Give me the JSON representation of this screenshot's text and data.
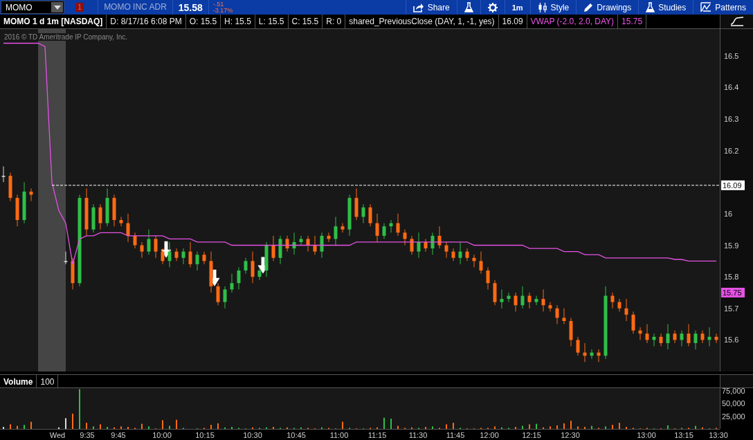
{
  "symbol_bar": {
    "symbol": "MOMO",
    "alert_count": "1",
    "company": "MOMO INC ADR",
    "last": "15.58",
    "change": "-.51",
    "change_pct": "-3.17%"
  },
  "toolbar": [
    {
      "kind": "share",
      "label": "Share"
    },
    {
      "kind": "flask"
    },
    {
      "kind": "gear"
    },
    {
      "kind": "text",
      "label": "1m"
    },
    {
      "kind": "style",
      "label": "Style"
    },
    {
      "kind": "pencil",
      "label": "Drawings"
    },
    {
      "kind": "flask",
      "label": "Studies"
    },
    {
      "kind": "patterns",
      "label": "Patterns"
    }
  ],
  "legend": [
    {
      "kind": "title",
      "text": "MOMO 1 d 1m [NASDAQ]"
    },
    {
      "kind": "plain",
      "text": "D: 8/17/16 6:08 PM"
    },
    {
      "kind": "plain",
      "text": "O: 15.5"
    },
    {
      "kind": "plain",
      "text": "H: 15.5"
    },
    {
      "kind": "plain",
      "text": "L: 15.5"
    },
    {
      "kind": "plain",
      "text": "C: 15.5"
    },
    {
      "kind": "plain",
      "text": "R: 0"
    },
    {
      "kind": "plain",
      "text": "shared_PreviousClose (DAY, 1, -1, yes)"
    },
    {
      "kind": "plain",
      "text": "16.09"
    },
    {
      "kind": "study",
      "text": "VWAP (-2.0, 2.0, DAY)"
    },
    {
      "kind": "study",
      "text": "15.75"
    }
  ],
  "copyright": "2016 © TD Ameritrade IP Company, Inc.",
  "price_badges": [
    {
      "kind": "previous_close",
      "text": "16.09",
      "color": "#ffffff"
    },
    {
      "kind": "vwap",
      "text": "15.75",
      "color": "#e552e5"
    }
  ],
  "price_chart": {
    "chart_data": {
      "type": "candlestick",
      "ylim": [
        15.5,
        16.585
      ],
      "categories": [
        null,
        null,
        null,
        null,
        null,
        null,
        null,
        null,
        null,
        null,
        null,
        null,
        null,
        null,
        null,
        null,
        null,
        null,
        null,
        null,
        null,
        null,
        null,
        null,
        null,
        null,
        null,
        null,
        null,
        null,
        null,
        null,
        null,
        null,
        null,
        null,
        null,
        null,
        null,
        null,
        null,
        null,
        null,
        null,
        null,
        null,
        null,
        null,
        null,
        null,
        null,
        null,
        null,
        null,
        null,
        null,
        null,
        null,
        null,
        null,
        null,
        null,
        null,
        null,
        null,
        null,
        null,
        null,
        null,
        null,
        null,
        null,
        null,
        null,
        null,
        null,
        null,
        null,
        null,
        null,
        null,
        null,
        null,
        null,
        null,
        null,
        null,
        null,
        null,
        null,
        null,
        null,
        null,
        null,
        null,
        null,
        null,
        null,
        null,
        null,
        null,
        null,
        null,
        null
      ],
      "yticks": [
        {
          "value": 15.6,
          "label": "15.6"
        },
        {
          "value": 15.7,
          "label": "15.7"
        },
        {
          "value": 15.8,
          "label": "15.8"
        },
        {
          "value": 15.9,
          "label": "15.9"
        },
        {
          "value": 16,
          "label": "16"
        },
        {
          "value": 16.2,
          "label": "16.2"
        },
        {
          "value": 16.3,
          "label": "16.3"
        },
        {
          "value": 16.4,
          "label": "16.4"
        },
        {
          "value": 16.5,
          "label": "16.5"
        }
      ],
      "ref_lines": [
        {
          "axis": "y",
          "value": 16.09
        }
      ],
      "ohlc": [
        [
          16.12,
          16.15,
          16.1,
          16.12
        ],
        [
          16.12,
          16.13,
          16.04,
          16.05
        ],
        [
          16.05,
          16.06,
          15.96,
          15.98
        ],
        [
          15.98,
          16.1,
          15.97,
          16.07
        ],
        [
          16.07,
          16.08,
          16.04,
          16.06
        ],
        null,
        null,
        null,
        null,
        [
          15.85,
          15.88,
          15.84,
          15.85
        ],
        [
          15.85,
          15.86,
          15.76,
          15.78
        ],
        [
          15.78,
          16.06,
          15.77,
          16.05
        ],
        [
          16.05,
          16.08,
          15.93,
          15.95
        ],
        [
          15.95,
          16.03,
          15.94,
          16.02
        ],
        [
          16.02,
          16.03,
          15.95,
          15.97
        ],
        [
          15.97,
          16.08,
          15.96,
          16.05
        ],
        [
          16.05,
          16.06,
          15.96,
          15.98
        ],
        [
          15.98,
          15.99,
          15.96,
          15.97
        ],
        [
          15.97,
          16,
          15.91,
          15.93
        ],
        [
          15.93,
          15.94,
          15.89,
          15.9
        ],
        [
          15.9,
          15.91,
          15.86,
          15.88
        ],
        [
          15.88,
          15.95,
          15.87,
          15.92
        ],
        [
          15.92,
          15.93,
          15.86,
          15.88
        ],
        [
          15.88,
          15.89,
          15.84,
          15.85
        ],
        [
          15.85,
          15.91,
          15.83,
          15.88
        ],
        [
          15.88,
          15.89,
          15.85,
          15.86
        ],
        [
          15.86,
          15.89,
          15.84,
          15.88
        ],
        [
          15.88,
          15.91,
          15.83,
          15.84
        ],
        [
          15.84,
          15.88,
          15.82,
          15.87
        ],
        [
          15.87,
          15.88,
          15.84,
          15.85
        ],
        [
          15.85,
          15.88,
          15.75,
          15.77
        ],
        [
          15.77,
          15.78,
          15.71,
          15.72
        ],
        [
          15.72,
          15.77,
          15.7,
          15.76
        ],
        [
          15.76,
          15.81,
          15.75,
          15.78
        ],
        [
          15.78,
          15.83,
          15.76,
          15.82
        ],
        [
          15.82,
          15.86,
          15.81,
          15.85
        ],
        [
          15.85,
          15.88,
          15.78,
          15.8
        ],
        [
          15.8,
          15.83,
          15.79,
          15.82
        ],
        [
          15.82,
          15.91,
          15.8,
          15.9
        ],
        [
          15.9,
          15.93,
          15.85,
          15.86
        ],
        [
          15.86,
          15.93,
          15.84,
          15.92
        ],
        [
          15.92,
          15.93,
          15.88,
          15.89
        ],
        [
          15.89,
          15.94,
          15.87,
          15.91
        ],
        [
          15.91,
          15.93,
          15.9,
          15.92
        ],
        [
          15.92,
          15.93,
          15.88,
          15.9
        ],
        [
          15.9,
          15.93,
          15.87,
          15.88
        ],
        [
          15.88,
          15.94,
          15.86,
          15.93
        ],
        [
          15.93,
          15.94,
          15.91,
          15.92
        ],
        [
          15.92,
          15.99,
          15.9,
          15.96
        ],
        [
          15.96,
          15.97,
          15.94,
          15.95
        ],
        [
          15.95,
          16.06,
          15.93,
          16.05
        ],
        [
          16.05,
          16.08,
          15.98,
          15.99
        ],
        [
          15.99,
          16.03,
          15.97,
          16.02
        ],
        [
          16.02,
          16.03,
          15.96,
          15.97
        ],
        [
          15.97,
          16,
          15.91,
          15.93
        ],
        [
          15.93,
          15.97,
          15.92,
          15.96
        ],
        [
          15.96,
          15.98,
          15.94,
          15.97
        ],
        [
          15.97,
          16,
          15.93,
          15.94
        ],
        [
          15.94,
          15.95,
          15.9,
          15.92
        ],
        [
          15.92,
          15.93,
          15.87,
          15.88
        ],
        [
          15.88,
          15.94,
          15.86,
          15.91
        ],
        [
          15.91,
          15.92,
          15.88,
          15.89
        ],
        [
          15.89,
          15.94,
          15.87,
          15.93
        ],
        [
          15.93,
          15.96,
          15.89,
          15.9
        ],
        [
          15.9,
          15.91,
          15.86,
          15.88
        ],
        [
          15.88,
          15.89,
          15.85,
          15.86
        ],
        [
          15.86,
          15.91,
          15.84,
          15.88
        ],
        [
          15.88,
          15.89,
          15.85,
          15.86
        ],
        [
          15.86,
          15.87,
          15.83,
          15.85
        ],
        [
          15.85,
          15.88,
          15.81,
          15.82
        ],
        [
          15.82,
          15.83,
          15.76,
          15.78
        ],
        [
          15.78,
          15.79,
          15.71,
          15.72
        ],
        [
          15.72,
          15.76,
          15.7,
          15.73
        ],
        [
          15.73,
          15.75,
          15.72,
          15.74
        ],
        [
          15.74,
          15.75,
          15.69,
          15.71
        ],
        [
          15.71,
          15.77,
          15.7,
          15.74
        ],
        [
          15.74,
          15.75,
          15.7,
          15.72
        ],
        [
          15.72,
          15.74,
          15.71,
          15.73
        ],
        [
          15.73,
          15.76,
          15.69,
          15.71
        ],
        [
          15.71,
          15.72,
          15.69,
          15.7
        ],
        [
          15.7,
          15.71,
          15.65,
          15.67
        ],
        [
          15.67,
          15.7,
          15.65,
          15.66
        ],
        [
          15.66,
          15.67,
          15.58,
          15.6
        ],
        [
          15.6,
          15.61,
          15.55,
          15.56
        ],
        [
          15.56,
          15.59,
          15.53,
          15.55
        ],
        [
          15.55,
          15.57,
          15.54,
          15.56
        ],
        [
          15.56,
          15.57,
          15.53,
          15.55
        ],
        [
          15.55,
          15.77,
          15.54,
          15.74
        ],
        [
          15.74,
          15.75,
          15.7,
          15.72
        ],
        [
          15.72,
          15.73,
          15.69,
          15.7
        ],
        [
          15.7,
          15.73,
          15.66,
          15.68
        ],
        [
          15.68,
          15.69,
          15.62,
          15.63
        ],
        [
          15.63,
          15.64,
          15.6,
          15.62
        ],
        [
          15.62,
          15.65,
          15.59,
          15.6
        ],
        [
          15.6,
          15.62,
          15.58,
          15.61
        ],
        [
          15.61,
          15.62,
          15.58,
          15.59
        ],
        [
          15.59,
          15.65,
          15.57,
          15.62
        ],
        [
          15.62,
          15.63,
          15.59,
          15.6
        ],
        [
          15.6,
          15.63,
          15.58,
          15.62
        ],
        [
          15.62,
          15.65,
          15.58,
          15.59
        ],
        [
          15.59,
          15.63,
          15.57,
          15.62
        ],
        [
          15.62,
          15.63,
          15.59,
          15.6
        ],
        [
          15.6,
          15.64,
          15.58,
          15.61
        ],
        [
          15.61,
          15.62,
          15.59,
          15.6
        ]
      ],
      "series": [
        {
          "type": "line",
          "color": "#e552e5",
          "values": [
            16.54,
            16.54,
            16.54,
            16.54,
            16.54,
            16.54,
            16.53,
            16.1,
            16.01,
            15.97,
            15.84,
            15.92,
            15.93,
            15.93,
            15.94,
            15.94,
            15.94,
            15.94,
            15.93,
            15.93,
            15.93,
            15.93,
            15.93,
            15.93,
            15.92,
            15.92,
            15.92,
            15.92,
            15.91,
            15.91,
            15.91,
            15.91,
            15.91,
            15.9,
            15.9,
            15.9,
            15.9,
            15.9,
            15.9,
            15.9,
            15.9,
            15.9,
            15.9,
            15.9,
            15.9,
            15.9,
            15.9,
            15.9,
            15.9,
            15.9,
            15.9,
            15.91,
            15.91,
            15.91,
            15.91,
            15.91,
            15.91,
            15.91,
            15.91,
            15.91,
            15.91,
            15.91,
            15.91,
            15.91,
            15.91,
            15.91,
            15.91,
            15.91,
            15.9,
            15.9,
            15.9,
            15.9,
            15.9,
            15.9,
            15.9,
            15.9,
            15.89,
            15.89,
            15.89,
            15.89,
            15.89,
            15.88,
            15.88,
            15.88,
            15.87,
            15.87,
            15.87,
            15.86,
            15.86,
            15.86,
            15.86,
            15.86,
            15.86,
            15.86,
            15.86,
            15.86,
            15.86,
            15.855,
            15.855,
            15.85,
            15.85,
            15.85,
            15.85,
            15.85
          ]
        }
      ]
    }
  },
  "time_axis": [
    "Wed",
    "9:35",
    "9:45",
    "10:00",
    "10:15",
    "10:30",
    "10:45",
    "11:00",
    "11:15",
    "11:30",
    "11:45",
    "12:00",
    "12:15",
    "12:30",
    "13:00",
    "13:15",
    "13:30"
  ],
  "volume_pane": {
    "label": "Volume",
    "value": "100",
    "chart_data": {
      "type": "bar",
      "ylim": [
        0,
        80000
      ],
      "yticks": [
        {
          "value": 25000,
          "label": "25,000"
        },
        {
          "value": 50000,
          "label": "50,000"
        },
        {
          "value": 75000,
          "label": "75,000"
        }
      ],
      "series": [
        {
          "color": "#2fbf48",
          "values": [
            null,
            null,
            null,
            8000,
            null,
            null,
            null,
            null,
            null,
            null,
            null,
            78000,
            null,
            5000,
            null,
            4000,
            null,
            null,
            null,
            null,
            null,
            5000,
            null,
            null,
            6000,
            null,
            2000,
            null,
            1000,
            null,
            null,
            null,
            3000,
            4000,
            2000,
            1000,
            null,
            2000,
            3000,
            null,
            2000,
            null,
            2000,
            3000,
            null,
            null,
            3000,
            null,
            1000,
            null,
            2000,
            null,
            1000,
            null,
            null,
            22000,
            20000,
            null,
            null,
            null,
            2000,
            null,
            5000,
            null,
            null,
            null,
            2000,
            null,
            null,
            null,
            null,
            null,
            3000,
            2000,
            null,
            6000,
            null,
            10000,
            null,
            null,
            null,
            null,
            null,
            null,
            null,
            6000,
            null,
            5000,
            null,
            null,
            null,
            null,
            null,
            null,
            1000,
            null,
            7000,
            null,
            2000,
            null,
            6000,
            null,
            1000,
            null
          ]
        },
        {
          "color": "#ff6a13",
          "values": [
            null,
            9000,
            6000,
            null,
            14000,
            null,
            null,
            null,
            null,
            null,
            30000,
            null,
            12000,
            null,
            9000,
            null,
            3000,
            5000,
            4000,
            2000,
            10000,
            null,
            1000,
            17000,
            null,
            18000,
            null,
            null,
            null,
            2000,
            8000,
            11000,
            null,
            null,
            null,
            null,
            3000,
            null,
            null,
            4000,
            null,
            3000,
            null,
            null,
            2000,
            1000,
            null,
            2000,
            null,
            14000,
            null,
            1000,
            null,
            2000,
            3000,
            null,
            null,
            6000,
            2000,
            3000,
            null,
            4000,
            null,
            2000,
            9000,
            12000,
            null,
            1000,
            1000,
            2000,
            2000,
            5000,
            null,
            null,
            4000,
            null,
            9000,
            null,
            3000,
            5000,
            7000,
            11000,
            16000,
            5000,
            4000,
            null,
            2000,
            null,
            8000,
            12000,
            4000,
            2000,
            1000,
            2000,
            null,
            1000,
            null,
            1000,
            null,
            2000,
            null,
            3000,
            null,
            2000
          ]
        },
        {
          "color": "#dddddd",
          "values": [
            4000,
            null,
            null,
            null,
            null,
            null,
            null,
            null,
            3000,
            21000,
            null,
            null,
            null,
            null,
            null,
            null,
            null,
            null,
            null,
            null,
            null,
            null,
            null,
            null,
            null,
            null,
            null,
            null,
            null,
            null,
            null,
            null,
            null,
            null,
            null,
            null,
            null,
            null,
            null,
            null,
            null,
            null,
            null,
            null,
            null,
            null,
            null,
            null,
            null,
            null,
            null,
            null,
            null,
            null,
            null,
            null,
            null,
            null,
            null,
            null,
            null,
            null,
            null,
            null,
            null,
            null,
            null,
            null,
            null,
            null,
            null,
            null,
            null,
            null,
            null,
            null,
            null,
            null,
            null,
            null,
            null,
            null,
            null,
            null,
            null,
            null,
            null,
            null,
            null,
            null,
            null,
            null,
            null,
            null,
            null,
            null,
            null,
            null,
            null,
            null,
            null,
            null,
            null,
            null
          ]
        }
      ]
    }
  }
}
